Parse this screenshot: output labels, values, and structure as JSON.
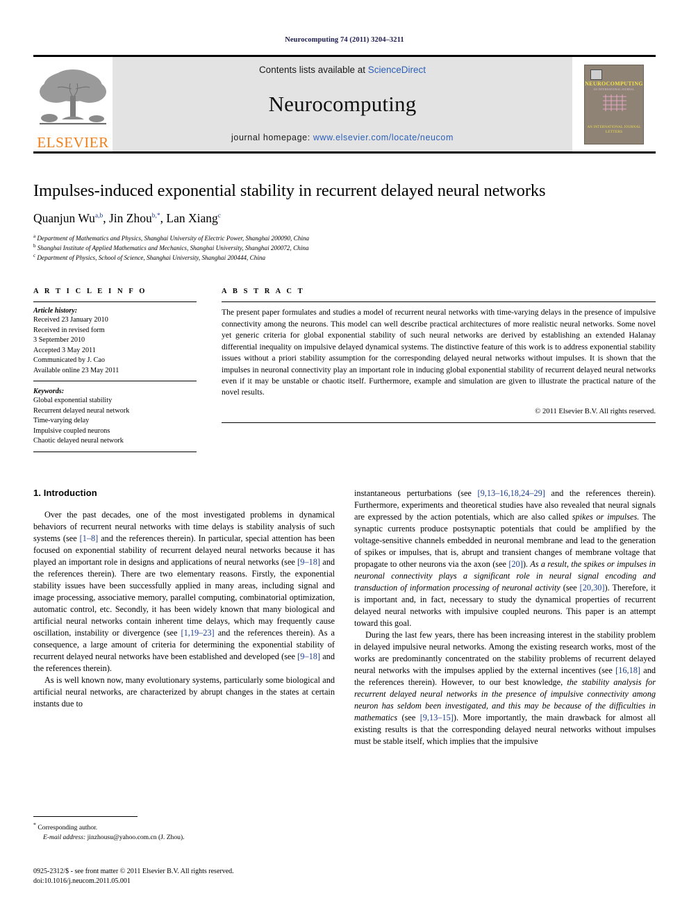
{
  "running_head": "Neurocomputing 74 (2011) 3204–3211",
  "masthead": {
    "contents_prefix": "Contents lists available at ",
    "sciencedirect": "ScienceDirect",
    "journal_name": "Neurocomputing",
    "homepage_prefix": "journal homepage: ",
    "homepage_url": "www.elsevier.com/locate/neucom",
    "publisher_wordmark": "ELSEVIER",
    "publisher_color": "#F07F1A",
    "link_color": "#2b5fb8",
    "cover": {
      "title": "NEUROCOMPUTING",
      "subtitle": "AN INTERNATIONAL JOURNAL",
      "footer_line1": "AN INTERNATIONAL JOURNAL",
      "footer_line2": "LETTERS"
    }
  },
  "article": {
    "title": "Impulses-induced exponential stability in recurrent delayed neural networks",
    "authors_html": "Quanjun Wu, Jin Zhou, Lan Xiang",
    "authors": [
      {
        "name": "Quanjun Wu",
        "marks": "a,b"
      },
      {
        "name": "Jin Zhou",
        "marks": "b,*"
      },
      {
        "name": "Lan Xiang",
        "marks": "c"
      }
    ],
    "affiliations": [
      {
        "mark": "a",
        "text": "Department of Mathematics and Physics, Shanghai University of Electric Power, Shanghai 200090, China"
      },
      {
        "mark": "b",
        "text": "Shanghai Institute of Applied Mathematics and Mechanics, Shanghai University, Shanghai 200072, China"
      },
      {
        "mark": "c",
        "text": "Department of Physics, School of Science, Shanghai University, Shanghai 200444, China"
      }
    ]
  },
  "article_info": {
    "heading": "A R T I C L E  I N F O",
    "history_label": "Article history:",
    "history": [
      "Received 23 January 2010",
      "Received in revised form",
      "3 September 2010",
      "Accepted 3 May 2011",
      "Communicated by J. Cao",
      "Available online 23 May 2011"
    ],
    "keywords_label": "Keywords:",
    "keywords": [
      "Global exponential stability",
      "Recurrent delayed neural network",
      "Time-varying delay",
      "Impulsive coupled neurons",
      "Chaotic delayed neural network"
    ]
  },
  "abstract": {
    "heading": "A B S T R A C T",
    "text": "The present paper formulates and studies a model of recurrent neural networks with time-varying delays in the presence of impulsive connectivity among the neurons. This model can well describe practical architectures of more realistic neural networks. Some novel yet generic criteria for global exponential stability of such neural networks are derived by establishing an extended Halanay differential inequality on impulsive delayed dynamical systems. The distinctive feature of this work is to address exponential stability issues without a priori stability assumption for the corresponding delayed neural networks without impulses. It is shown that the impulses in neuronal connectivity play an important role in inducing global exponential stability of recurrent delayed neural networks even if it may be unstable or chaotic itself. Furthermore, example and simulation are given to illustrate the practical nature of the novel results.",
    "copyright": "© 2011 Elsevier B.V. All rights reserved."
  },
  "body": {
    "section_title": "1.  Introduction",
    "left_paragraphs": [
      "Over the past decades, one of the most investigated problems in dynamical behaviors of recurrent neural networks with time delays is stability analysis of such systems (see [1–8] and the references therein). In particular, special attention has been focused on exponential stability of recurrent delayed neural networks because it has played an important role in designs and applications of neural networks (see [9–18] and the references therein). There are two elementary reasons. Firstly, the exponential stability issues have been successfully applied in many areas, including signal and image processing, associative memory, parallel computing, combinatorial optimization, automatic control, etc. Secondly, it has been widely known that many biological and artificial neural networks contain inherent time delays, which may frequently cause oscillation, instability or divergence (see [1,19–23] and the references therein). As a consequence, a large amount of criteria for determining the exponential stability of recurrent delayed neural networks have been established and developed (see [9–18] and the references therein).",
      "As is well known now, many evolutionary systems, particularly some biological and artificial neural networks, are characterized by abrupt changes in the states at certain instants due to"
    ],
    "right_paragraphs": [
      "instantaneous perturbations (see [9,13–16,18,24–29] and the references therein). Furthermore, experiments and theoretical studies have also revealed that neural signals are expressed by the action potentials, which are also called spikes or impulses. The synaptic currents produce postsynaptic potentials that could be amplified by the voltage-sensitive channels embedded in neuronal membrane and lead to the generation of spikes or impulses, that is, abrupt and transient changes of membrane voltage that propagate to other neurons via the axon (see [20]). As a result, the spikes or impulses in neuronal connectivity plays a significant role in neural signal encoding and transduction of information processing of neuronal activity (see [20,30]). Therefore, it is important and, in fact, necessary to study the dynamical properties of recurrent delayed neural networks with impulsive coupled neurons. This paper is an attempt toward this goal.",
      "During the last few years, there has been increasing interest in the stability problem in delayed impulsive neural networks. Among the existing research works, most of the works are predominantly concentrated on the stability problems of recurrent delayed neural networks with the impulses applied by the external incentives (see [16,18] and the references therein). However, to our best knowledge, the stability analysis for recurrent delayed neural networks in the presence of impulsive connectivity among neuron has seldom been investigated, and this may be because of the difficulties in mathematics (see [9,13–15]). More importantly, the main drawback for almost all existing results is that the corresponding delayed neural networks without impulses must be stable itself, which implies that the impulsive"
    ]
  },
  "footnote": {
    "corresponding": "Corresponding author.",
    "email_label": "E-mail address:",
    "email": "jinzhousu@yahoo.com.cn (J. Zhou)."
  },
  "imprint": {
    "line1": "0925-2312/$ - see front matter © 2011 Elsevier B.V. All rights reserved.",
    "line2": "doi:10.1016/j.neucom.2011.05.001"
  }
}
